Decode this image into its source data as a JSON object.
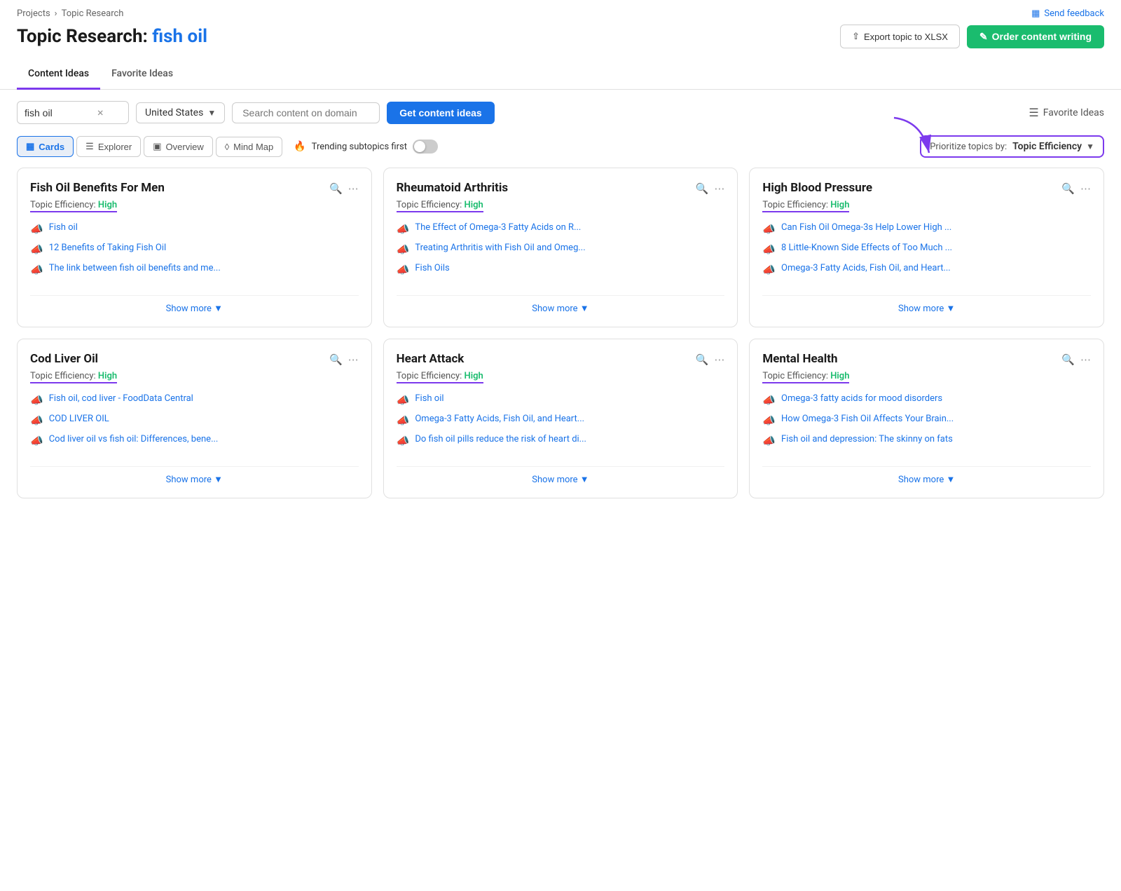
{
  "breadcrumb": {
    "projects": "Projects",
    "sep": "›",
    "current": "Topic Research"
  },
  "send_feedback": "Send feedback",
  "page_title": {
    "prefix": "Topic Research: ",
    "topic": "fish oil"
  },
  "header_actions": {
    "export_label": "Export topic to XLSX",
    "order_label": "Order content writing"
  },
  "tabs": [
    {
      "label": "Content Ideas",
      "active": true
    },
    {
      "label": "Favorite Ideas",
      "active": false
    }
  ],
  "controls": {
    "search_value": "fish oil",
    "country": "United States",
    "domain_placeholder": "Search content on domain",
    "get_ideas_label": "Get content ideas",
    "fav_ideas_label": "Favorite Ideas"
  },
  "view_buttons": [
    {
      "label": "Cards",
      "active": true,
      "icon": "grid"
    },
    {
      "label": "Explorer",
      "active": false,
      "icon": "table"
    },
    {
      "label": "Overview",
      "active": false,
      "icon": "overview"
    },
    {
      "label": "Mind Map",
      "active": false,
      "icon": "mindmap"
    }
  ],
  "trending": {
    "label": "Trending subtopics first",
    "enabled": false
  },
  "prioritize": {
    "label": "Prioritize topics by:",
    "value": "Topic Efficiency"
  },
  "cards": [
    {
      "title": "Fish Oil Benefits For Men",
      "efficiency_label": "Topic Efficiency: ",
      "efficiency_value": "High",
      "items": [
        "Fish oil",
        "12 Benefits of Taking Fish Oil",
        "The link between fish oil benefits and me..."
      ],
      "show_more": "Show more"
    },
    {
      "title": "Rheumatoid Arthritis",
      "efficiency_label": "Topic Efficiency: ",
      "efficiency_value": "High",
      "items": [
        "The Effect of Omega-3 Fatty Acids on R...",
        "Treating Arthritis with Fish Oil and Omeg...",
        "Fish Oils"
      ],
      "show_more": "Show more"
    },
    {
      "title": "High Blood Pressure",
      "efficiency_label": "Topic Efficiency: ",
      "efficiency_value": "High",
      "items": [
        "Can Fish Oil Omega-3s Help Lower High ...",
        "8 Little-Known Side Effects of Too Much ...",
        "Omega-3 Fatty Acids, Fish Oil, and Heart..."
      ],
      "show_more": "Show more"
    },
    {
      "title": "Cod Liver Oil",
      "efficiency_label": "Topic Efficiency: ",
      "efficiency_value": "High",
      "items": [
        "Fish oil, cod liver - FoodData Central",
        "COD LIVER OIL",
        "Cod liver oil vs fish oil: Differences, bene..."
      ],
      "show_more": "Show more"
    },
    {
      "title": "Heart Attack",
      "efficiency_label": "Topic Efficiency: ",
      "efficiency_value": "High",
      "items": [
        "Fish oil",
        "Omega-3 Fatty Acids, Fish Oil, and Heart...",
        "Do fish oil pills reduce the risk of heart di..."
      ],
      "show_more": "Show more"
    },
    {
      "title": "Mental Health",
      "efficiency_label": "Topic Efficiency: ",
      "efficiency_value": "High",
      "items": [
        "Omega-3 fatty acids for mood disorders",
        "How Omega-3 Fish Oil Affects Your Brain...",
        "Fish oil and depression: The skinny on fats"
      ],
      "show_more": "Show more"
    }
  ]
}
